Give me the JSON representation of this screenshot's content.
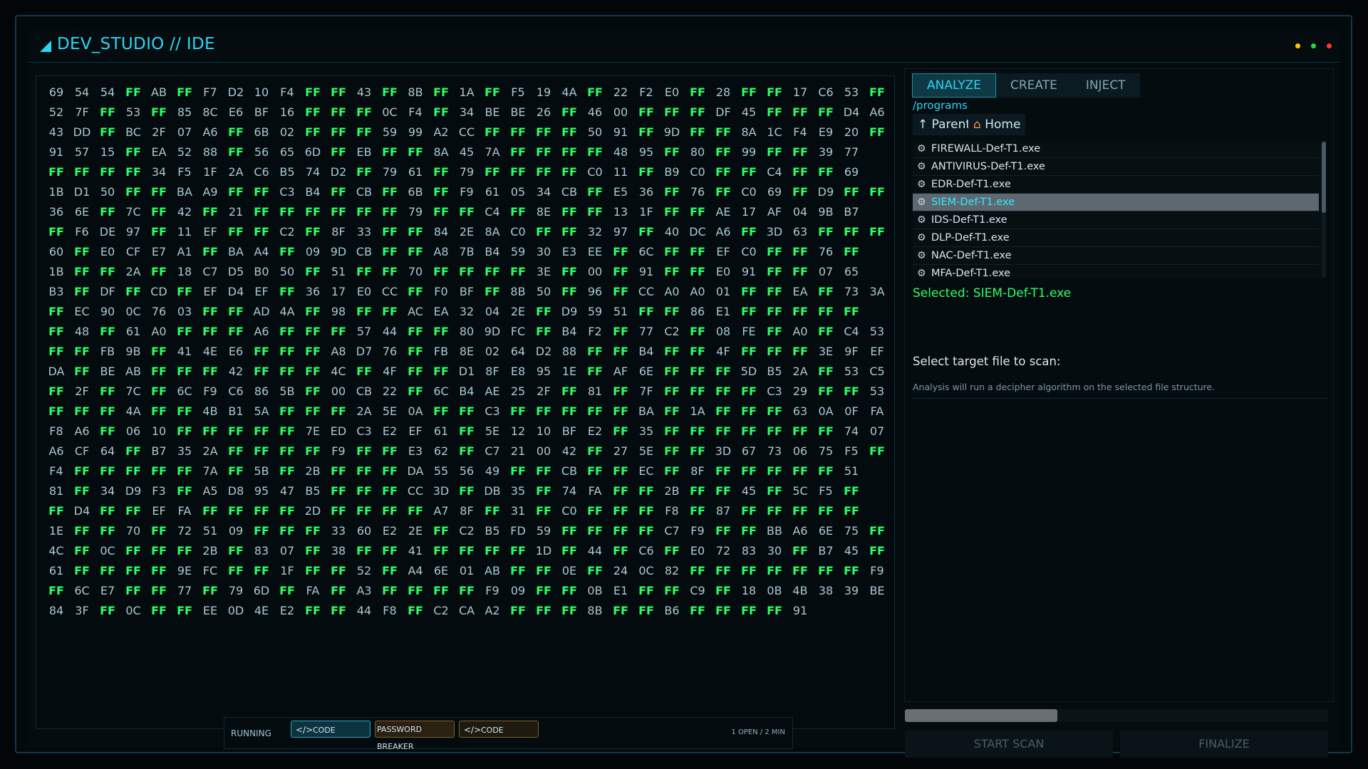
{
  "app": {
    "title": "DEV_STUDIO // IDE"
  },
  "window_controls": {
    "colors": [
      "#ffc900",
      "#2bd649",
      "#ff3b30"
    ]
  },
  "hex": {
    "rows": [
      "69 54 54 FF AB FF F7 D2 10 F4 FF FF 43 FF 8B FF 1A FF F5 19 4A FF 22 F2 E0 FF 28 FF FF 17 C6 53 FF",
      "52 7F FF 53 FF 85 8C E6 BF 16 FF FF FF 0C F4 FF 34 BE BE 26 FF 46 00 FF FF FF DF 45 FF FF FF D4 A6",
      "43 DD FF BC 2F 07 A6 FF 6B 02 FF FF FF 59 99 A2 CC FF FF FF FF 50 91 FF 9D FF FF 8A 1C F4 E9 20 FF",
      "91 57 15 FF EA 52 88 FF 56 65 6D FF EB FF FF 8A 45 7A FF FF FF FF 48 95 FF 80 FF 99 FF FF 39 77",
      "FF FF FF FF 34 F5 1F 2A C6 B5 74 D2 FF 79 61 FF 79 FF FF FF FF C0 11 FF B9 C0 FF FF C4 FF FF 69",
      "1B D1 50 FF FF BA A9 FF FF C3 B4 FF CB FF 6B FF F9 61 05 34 CB FF E5 36 FF 76 FF C0 69 FF D9 FF FF",
      "36 6E FF 7C FF 42 FF 21 FF FF FF FF FF FF 79 FF FF C4 FF 8E FF FF 13 1F FF FF AE 17 AF 04 9B B7",
      "FF F6 DE 97 FF 11 EF FF FF C2 FF 8F 33 FF FF 84 2E 8A C0 FF FF 32 97 FF 40 DC A6 FF 3D 63 FF FF FF",
      "60 FF E0 CF E7 A1 FF BA A4 FF 09 9D CB FF FF A8 7B B4 59 30 E3 EE FF 6C FF FF EF C0 FF FF 76 FF",
      "1B FF FF 2A FF 18 C7 D5 B0 50 FF 51 FF FF 70 FF FF FF FF 3E FF 00 FF 91 FF FF E0 91 FF FF 07 65",
      "B3 FF DF FF CD FF EF D4 EF FF 36 17 E0 CC FF F0 BF FF 8B 50 FF 96 FF CC A0 A0 01 FF FF EA FF 73 3A",
      "FF EC 90 0C 76 03 FF FF AD 4A FF 98 FF FF AC EA 32 04 2E FF D9 59 51 FF FF 86 E1 FF FF FF FF FF",
      "FF 48 FF 61 A0 FF FF FF A6 FF FF FF 57 44 FF FF 80 9D FC FF B4 F2 FF 77 C2 FF 08 FE FF A0 FF C4 53",
      "FF FF FB 9B FF 41 4E E6 FF FF FF A8 D7 76 FF FB 8E 02 64 D2 88 FF FF B4 FF FF 4F FF FF FF 3E 9F EF",
      "DA FF BE AB FF FF FF 42 FF FF FF 4C FF 4F FF FF D1 8F E8 95 1E FF AF 6E FF FF FF 5D B5 2A FF 53 C5",
      "FF 2F FF 7C FF 6C F9 C6 86 5B FF 00 CB 22 FF 6C B4 AE 25 2F FF 81 FF 7F FF FF FF FF C3 29 FF FF 53",
      "FF FF FF 4A FF FF 4B B1 5A FF FF FF 2A 5E 0A FF FF C3 FF FF FF FF FF BA FF 1A FF FF FF 63 0A 0F FA",
      "F8 A6 FF 06 10 FF FF FF FF FF 7E ED C3 E2 EF 61 FF 5E 12 10 BF E2 FF 35 FF FF FF FF FF FF FF 74 07",
      "A6 CF 64 FF B7 35 2A FF FF FF FF F9 FF FF E3 62 FF C7 21 00 42 FF 27 5E FF FF 3D 67 73 06 75 F5 FF",
      "F4 FF FF FF FF FF 7A FF 5B FF 2B FF FF FF DA 55 56 49 FF FF CB FF FF EC FF 8F FF FF FF FF FF 51",
      "81 FF 34 D9 F3 FF A5 D8 95 47 B5 FF FF FF CC 3D FF DB 35 FF 74 FA FF FF 2B FF FF 45 FF 5C F5 FF",
      "FF D4 FF FF EF FA FF FF FF FF 2D FF FF FF FF A7 8F FF 31 FF C0 FF FF FF F8 FF 87 FF FF FF FF FF",
      "1E FF FF 70 FF 72 51 09 FF FF FF 33 60 E2 2E FF C2 B5 FD 59 FF FF FF FF C7 F9 FF FF BB A6 6E 75 FF",
      "4C FF 0C FF FF FF 2B FF 83 07 FF 38 FF FF 41 FF FF FF FF 1D FF 44 FF C6 FF E0 72 83 30 FF B7 45 FF",
      "61 FF FF FF FF 9E FC FF FF 1F FF FF 52 FF A4 6E 01 AB FF FF 0E FF 24 0C 82 FF FF FF FF FF FF FF F9",
      "FF 6C E7 FF FF 77 FF 79 6D FF FA FF A3 FF FF FF FF F9 09 FF FF 0B E1 FF FF C9 FF 18 0B 4B 38 39 BE",
      "84 3F FF 0C FF FF EE 0D 4E E2 FF FF 44 F8 FF C2 CA A2 FF FF FF 8B FF FF B6 FF FF FF FF 91"
    ]
  },
  "right_panel": {
    "tabs": [
      {
        "label": "ANALYZE",
        "active": true
      },
      {
        "label": "CREATE",
        "active": false
      },
      {
        "label": "INJECT",
        "active": false
      }
    ],
    "path": "/programs",
    "nav": {
      "parent_label": "↑ Parent",
      "home_label": "Home"
    },
    "files": [
      {
        "name": "FIREWALL-Def-T1.exe",
        "selected": false
      },
      {
        "name": "ANTIVIRUS-Def-T1.exe",
        "selected": false
      },
      {
        "name": "EDR-Def-T1.exe",
        "selected": false
      },
      {
        "name": "SIEM-Def-T1.exe",
        "selected": true
      },
      {
        "name": "IDS-Def-T1.exe",
        "selected": false
      },
      {
        "name": "DLP-Def-T1.exe",
        "selected": false
      },
      {
        "name": "NAC-Def-T1.exe",
        "selected": false
      },
      {
        "name": "MFA-Def-T1.exe",
        "selected": false
      }
    ],
    "selected_text": "Selected: SIEM-Def-T1.exe",
    "scan_prompt": "Select target file to scan:",
    "scan_description": "Analysis will run a decipher algorithm on the selected file structure.",
    "progress_fraction": 0.36,
    "start_scan_label": "START SCAN",
    "finalize_label": "FINALIZE"
  },
  "taskbar": {
    "status": "RUNNING",
    "tasks": [
      {
        "label": "CODE",
        "icon": "code-icon"
      },
      {
        "label": "PASSWORD BREAKER",
        "icon": ""
      },
      {
        "label": "CODE",
        "icon": "code-icon"
      }
    ],
    "info": "1 OPEN / 2 MIN"
  }
}
